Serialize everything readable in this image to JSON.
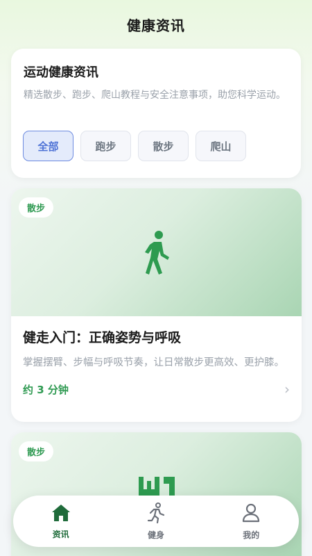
{
  "header": {
    "title": "健康资讯"
  },
  "intro": {
    "title": "运动健康资讯",
    "description": "精选散步、跑步、爬山教程与安全注意事项，助您科学运动。"
  },
  "filters": [
    {
      "label": "全部",
      "active": true
    },
    {
      "label": "跑步",
      "active": false
    },
    {
      "label": "散步",
      "active": false
    },
    {
      "label": "爬山",
      "active": false
    }
  ],
  "articles": [
    {
      "tag": "散步",
      "icon": "walking-person-icon",
      "title": "健走入门：正确姿势与呼吸",
      "description": "掌握摆臂、步幅与呼吸节奏，让日常散步更高效、更护膝。",
      "read_time": "约 3 分钟"
    },
    {
      "tag": "散步",
      "icon": "partial-glyph-icon"
    }
  ],
  "tabbar": [
    {
      "label": "资讯",
      "icon": "home-icon",
      "active": true
    },
    {
      "label": "健身",
      "icon": "running-person-icon",
      "active": false
    },
    {
      "label": "我的",
      "icon": "user-icon",
      "active": false
    }
  ],
  "colors": {
    "accent_green": "#2f9a52",
    "active_chip_blue": "#4f73d6",
    "tab_active": "#1f6b3a"
  }
}
